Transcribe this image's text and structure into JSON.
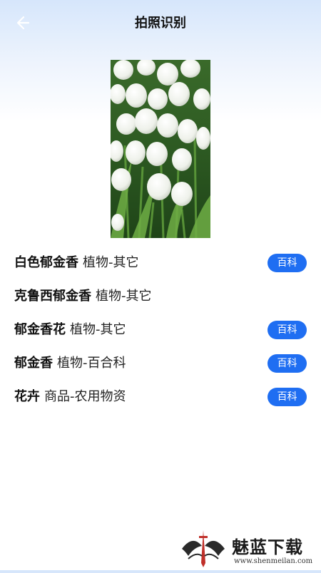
{
  "header": {
    "title": "拍照识别",
    "back_icon": "arrow-left-icon"
  },
  "photo": {
    "subject": "white tulips"
  },
  "results": [
    {
      "name": "白色郁金香",
      "category": "植物-其它",
      "button": "百科"
    },
    {
      "name": "克鲁西郁金香",
      "category": "植物-其它"
    },
    {
      "name": "郁金香花",
      "category": "植物-其它",
      "button": "百科"
    },
    {
      "name": "郁金香",
      "category": "植物-百合科",
      "button": "百科"
    },
    {
      "name": "花卉",
      "category": "商品-农用物资",
      "button": "百科"
    }
  ],
  "watermark": {
    "text": "魅蓝下载",
    "url": "www.shenmeilan.com"
  },
  "colors": {
    "accent": "#1f6ef2",
    "header_gradient_top": "#d6e6fb"
  }
}
